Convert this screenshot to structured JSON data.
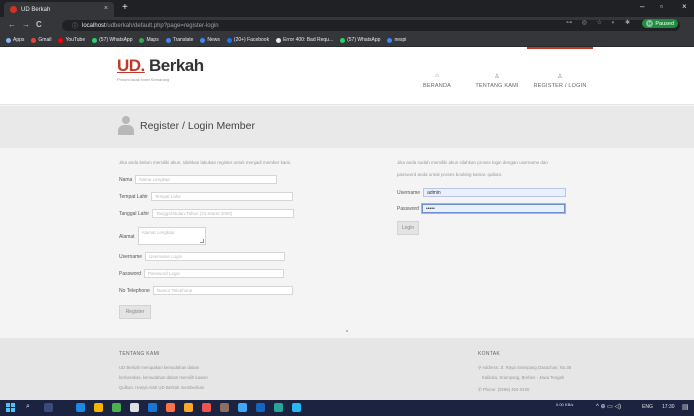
{
  "browser": {
    "tab_title": "UD Berkah",
    "tab_close": "×",
    "new_tab": "+",
    "window_controls": [
      "–",
      "▫",
      "×"
    ],
    "nav_back": "←",
    "nav_forward": "→",
    "nav_reload": "C",
    "url_host": "localhost",
    "url_path": "/udberkah/default.php?page=register-login",
    "omni_icons": "⊶ ◎ ☆ ◐ ✱",
    "profile_label": "Paused",
    "profile_initial": "H",
    "bookmarks": [
      {
        "label": "Apps",
        "color": "#8ab4f8"
      },
      {
        "label": "Gmail",
        "color": "#ea4335"
      },
      {
        "label": "YouTube",
        "color": "#ff0000"
      },
      {
        "label": "(57) WhatsApp",
        "color": "#25d366"
      },
      {
        "label": "Maps",
        "color": "#34a853"
      },
      {
        "label": "Translate",
        "color": "#4285f4"
      },
      {
        "label": "News",
        "color": "#4285f4"
      },
      {
        "label": "(20+) Facebook",
        "color": "#1877f2"
      },
      {
        "label": "Error 400: Bad Requ...",
        "color": "#e8eaed"
      },
      {
        "label": "(57) WhatsApp",
        "color": "#25d366"
      },
      {
        "label": "nespi",
        "color": "#4285f4"
      }
    ]
  },
  "site": {
    "logo_ud": "UD.",
    "logo_name": " Berkah",
    "tagline": "Proses lacak hotel Semarang",
    "nav": [
      {
        "label": "BERANDA",
        "icon": "⌂"
      },
      {
        "label": "TENTANG KAMI",
        "icon": "♙"
      },
      {
        "label": "REGISTER / LOGIN",
        "icon": "♙"
      }
    ],
    "page_title": "Register / Login Member",
    "register": {
      "intro": "Jika anda belum memiliki akun, silahkan lakukan register untuk menjadi member kami.",
      "fields": [
        {
          "label": "Nama",
          "placeholder": "Nama Lengkap"
        },
        {
          "label": "Tempat Lahir",
          "placeholder": "Tempat Lahir"
        },
        {
          "label": "Tanggal Lahir",
          "placeholder": "Tanggal-Bulan-Tahun (31-Maret-2000)"
        },
        {
          "label": "Alamat",
          "placeholder": "Alamat Lengkap"
        },
        {
          "label": "Username",
          "placeholder": "Username Login"
        },
        {
          "label": "Password",
          "placeholder": "Password Login"
        },
        {
          "label": "No Telephone",
          "placeholder": "Nomor Telephone"
        }
      ],
      "button": "Register"
    },
    "login": {
      "intro_line1": "Jika anda sudah memiliki akun silahkan proses login dengan username dan",
      "intro_line2": "password anda untuk proses booking kamar. quiban.",
      "username_label": "Username",
      "username_value": "admin",
      "password_label": "Password",
      "password_value": "•••••",
      "button": "Login"
    },
    "footer": {
      "about_title": "TENTANG KAMI",
      "about_lines": [
        "UD Berkah merupakan kemudahan dalam",
        "berberakas, kemudahan dalam memilih kawan",
        "Quiban, Hanya Alah UD Berkah memberikan"
      ],
      "contact_title": "KONTAK",
      "contact_lines": [
        "Address: Jl. Raya Srampang Dasachan, No.35",
        "Kaliloka, Srampang, Brebes - Jawa Tengah",
        "Phone: (0286) 404-0100"
      ]
    }
  },
  "taskbar": {
    "net_speed": "0.00 KB/s",
    "language": "ENG",
    "time": "17:30"
  }
}
